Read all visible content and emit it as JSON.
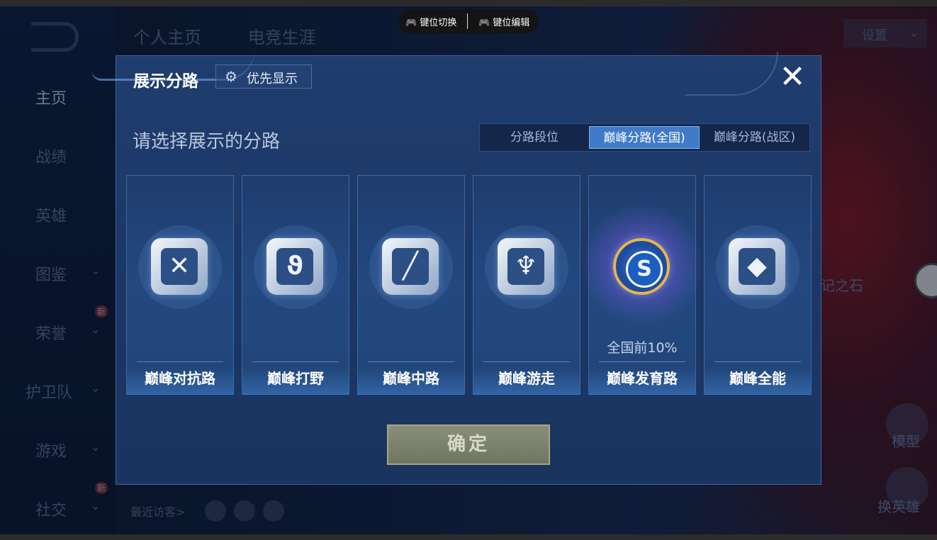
{
  "hud": {
    "key_switch": "键位切换",
    "key_edit": "键位编辑"
  },
  "sidebar": {
    "items": [
      {
        "label": "主页",
        "chevron": "",
        "badge": ""
      },
      {
        "label": "战绩",
        "chevron": "",
        "badge": ""
      },
      {
        "label": "英雄",
        "chevron": "",
        "badge": ""
      },
      {
        "label": "图鉴",
        "chevron": "⌄",
        "badge": ""
      },
      {
        "label": "荣誉",
        "chevron": "⌄",
        "badge": "新"
      },
      {
        "label": "护卫队",
        "chevron": "⌄",
        "badge": ""
      },
      {
        "label": "游戏",
        "chevron": "⌄",
        "badge": ""
      },
      {
        "label": "社交",
        "chevron": "⌄",
        "badge": "新"
      }
    ]
  },
  "top_tabs": [
    "个人主页",
    "电竞生涯"
  ],
  "settings": {
    "label": "设置",
    "arrow": "⌄"
  },
  "background": {
    "stone_label": "记之石",
    "model_label": "模型",
    "hero_label": "换英雄",
    "recent_visitors": "最近访客>"
  },
  "dialog": {
    "title": "展示分路",
    "priority_label": "优先显示",
    "close_glyph": "✕",
    "subtitle": "请选择展示的分路",
    "segment_tabs": [
      {
        "label": "分路段位",
        "active": false
      },
      {
        "label": "巅峰分路(全国)",
        "active": true
      },
      {
        "label": "巅峰分路(战区)",
        "active": false
      }
    ],
    "lanes": [
      {
        "name": "巅峰对抗路",
        "rank": "",
        "featured": false,
        "icon": "crossed-swords-icon"
      },
      {
        "name": "巅峰打野",
        "rank": "",
        "featured": false,
        "icon": "dragon-icon"
      },
      {
        "name": "巅峰中路",
        "rank": "",
        "featured": false,
        "icon": "diagonal-slash-icon"
      },
      {
        "name": "巅峰游走",
        "rank": "",
        "featured": false,
        "icon": "wings-icon"
      },
      {
        "name": "巅峰发育路",
        "rank": "全国前10%",
        "featured": true,
        "icon": "emblem-badge-icon"
      },
      {
        "name": "巅峰全能",
        "rank": "",
        "featured": false,
        "icon": "diamond-frame-icon"
      }
    ],
    "confirm_label": "确定"
  }
}
